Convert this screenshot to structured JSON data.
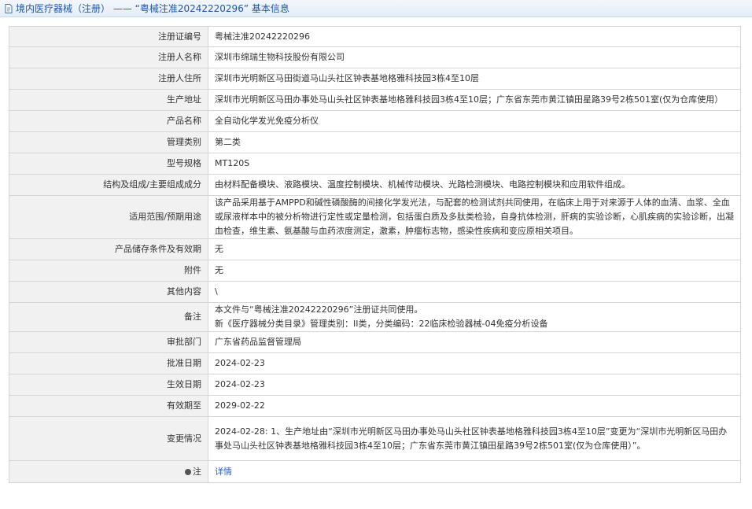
{
  "header": {
    "title": "境内医疗器械（注册） —— “粤械注准20242220296” 基本信息"
  },
  "rows": [
    {
      "label": "注册证编号",
      "value": "粤械注准20242220296"
    },
    {
      "label": "注册人名称",
      "value": "深圳市绵瑞生物科技股份有限公司"
    },
    {
      "label": "注册人住所",
      "value": "深圳市光明新区马田街道马山头社区钟表基地格雅科技园3栋4至10层"
    },
    {
      "label": "生产地址",
      "value": "深圳市光明新区马田办事处马山头社区钟表基地格雅科技园3栋4至10层；广东省东莞市黄江镇田星路39号2栋501室(仅为仓库使用）"
    },
    {
      "label": "产品名称",
      "value": "全自动化学发光免疫分析仪"
    },
    {
      "label": "管理类别",
      "value": "第二类"
    },
    {
      "label": "型号规格",
      "value": "MT120S"
    },
    {
      "label": "结构及组成/主要组成成分",
      "value": "由材料配备模块、液路模块、温度控制模块、机械传动模块、光路检测模块、电路控制模块和应用软件组成。"
    },
    {
      "label": "适用范围/预期用途",
      "value": "该产品采用基于AMPPD和碱性磷酸酶的间接化学发光法，与配套的检测试剂共同使用，在临床上用于对来源于人体的血清、血浆、全血或尿液样本中的被分析物进行定性或定量检测，包括蛋白质及多肽类检验，自身抗体检测，肝病的实验诊断，心肌疾病的实验诊断，出凝血检查，维生素、氨基酸与血药浓度测定，激素，肿瘤标志物，感染性疾病和变应原相关项目。"
    },
    {
      "label": "产品储存条件及有效期",
      "value": "无"
    },
    {
      "label": "附件",
      "value": "无"
    },
    {
      "label": "其他内容",
      "value": "\\"
    },
    {
      "label": "备注",
      "lines": [
        "本文件与“粤械注准20242220296”注册证共同使用。",
        "新《医疗器械分类目录》管理类别：II类，分类编码：22临床检验器械-04免疫分析设备"
      ]
    },
    {
      "label": "审批部门",
      "value": "广东省药品监督管理局"
    },
    {
      "label": "批准日期",
      "value": "2024-02-23"
    },
    {
      "label": "生效日期",
      "value": "2024-02-23"
    },
    {
      "label": "有效期至",
      "value": "2029-02-22"
    },
    {
      "label": "变更情况",
      "value": "2024-02-28: 1、生产地址由“深圳市光明新区马田办事处马山头社区钟表基地格雅科技园3栋4至10层”变更为“深圳市光明新区马田办事处马山头社区钟表基地格雅科技园3栋4至10层；广东省东莞市黄江镇田星路39号2栋501室(仅为仓库使用）”。"
    },
    {
      "label": "注",
      "value": "详情",
      "link": true,
      "icon": "pin-icon"
    }
  ]
}
